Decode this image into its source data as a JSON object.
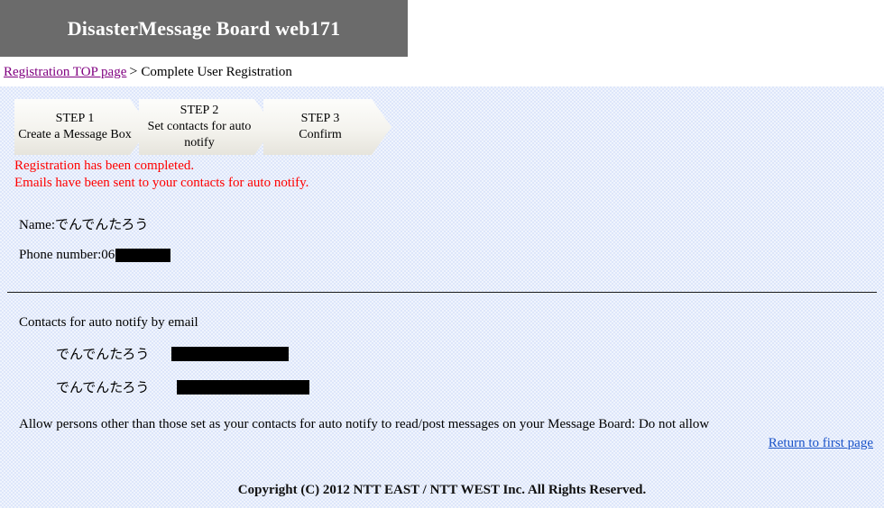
{
  "header": {
    "title": "DisasterMessage Board web171",
    "bg_color": "#6b6b6b",
    "text_color": "#ffffff"
  },
  "breadcrumb": {
    "link_label": "Registration TOP page",
    "separator": ">",
    "current_label": "Complete User Registration",
    "link_color": "#800080"
  },
  "steps": [
    {
      "number": "STEP 1",
      "caption": "Create a Message Box"
    },
    {
      "number": "STEP 2",
      "caption": "Set contacts for auto notify"
    },
    {
      "number": "STEP 3",
      "caption": "Confirm"
    }
  ],
  "status": {
    "line1": "Registration has been completed.",
    "line2": "Emails have been sent to your contacts for auto notify.",
    "color": "#ff0000"
  },
  "details": {
    "name_label": "Name:",
    "name_value": "でんでんたろう",
    "phone_label": "Phone number:",
    "phone_value_prefix": "06",
    "phone_value_redacted": true
  },
  "contacts": {
    "heading": "Contacts for auto notify by email",
    "rows": [
      {
        "name": "でんでんたろう",
        "email_redacted": true
      },
      {
        "name": "でんでんたろう",
        "email_redacted": true
      }
    ]
  },
  "allow_setting": {
    "text": "Allow persons other than those set as your contacts for auto notify to read/post messages on your Message Board: Do not allow"
  },
  "return_link": {
    "label": "Return to first page",
    "color": "#1a53c8"
  },
  "footer": {
    "copyright": "Copyright (C) 2012 NTT EAST / NTT WEST Inc. All Rights Reserved."
  },
  "colors": {
    "panel_bg": "#dde6fa",
    "page_bg": "#ffffff",
    "divider": "#1b1b1b"
  }
}
